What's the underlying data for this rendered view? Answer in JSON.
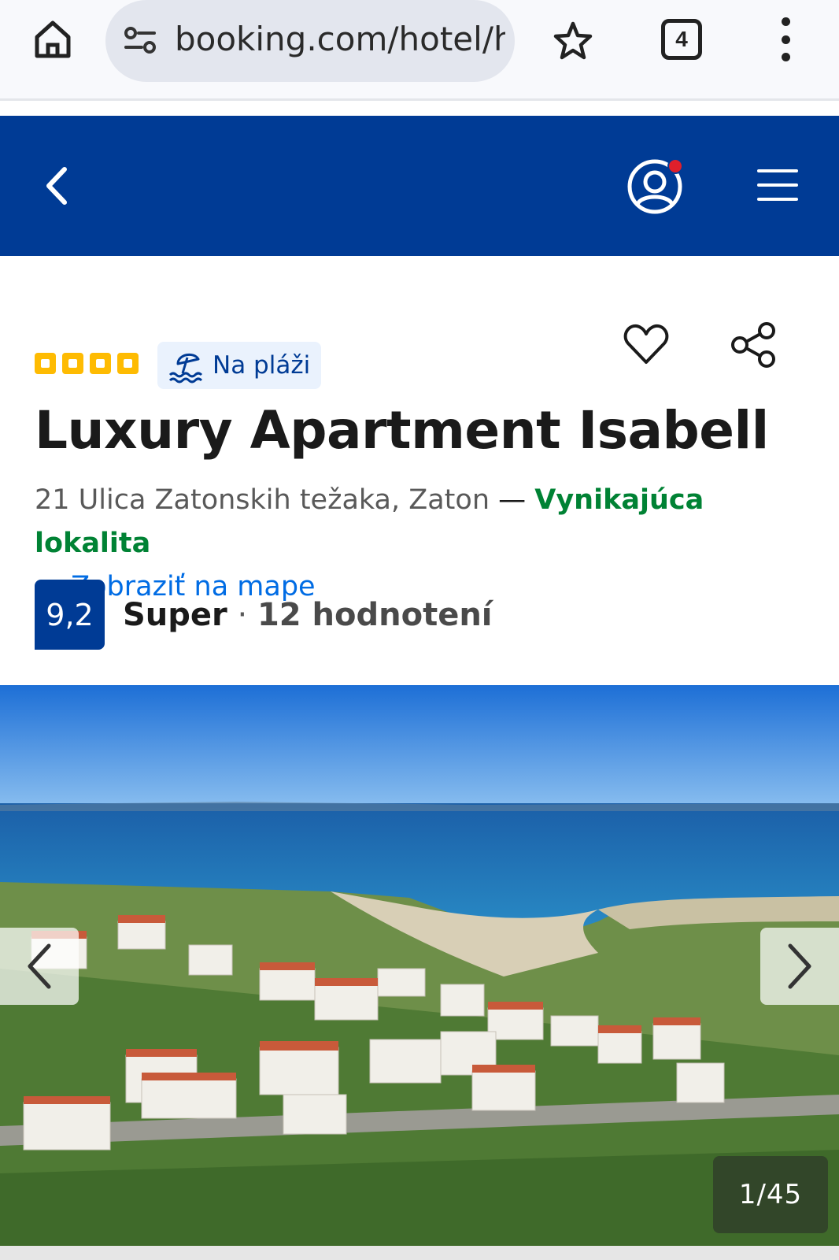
{
  "browser": {
    "url": "booking.com/hotel/hr/luxury-apartment-isabell",
    "tab_count": "4",
    "icons": [
      "home-icon",
      "site-settings-icon",
      "bookmark-star-icon",
      "tabs-counter-icon",
      "more-vert-icon"
    ]
  },
  "header": {
    "background_color": "#003b95",
    "icons": [
      "back-arrow-icon",
      "account-icon",
      "hamburger-menu-icon"
    ]
  },
  "property": {
    "star_count": 4,
    "star_color": "#febb02",
    "badge_label": "Na pláži",
    "badge_icon": "beach-umbrella-icon",
    "title": "Luxury Apartment Isabell",
    "address": "21 Ulica Zatonskih težaka, Zaton",
    "dash": "—",
    "location_quality": "Vynikajúca lokalita",
    "map_link": "Zobraziť na mape",
    "rating_score": "9,2",
    "rating_word": "Super",
    "rating_separator": "·",
    "review_count_text": "12 hodnotení"
  },
  "gallery": {
    "counter": "1/45",
    "icons": [
      "chevron-left-icon",
      "chevron-right-icon"
    ]
  }
}
